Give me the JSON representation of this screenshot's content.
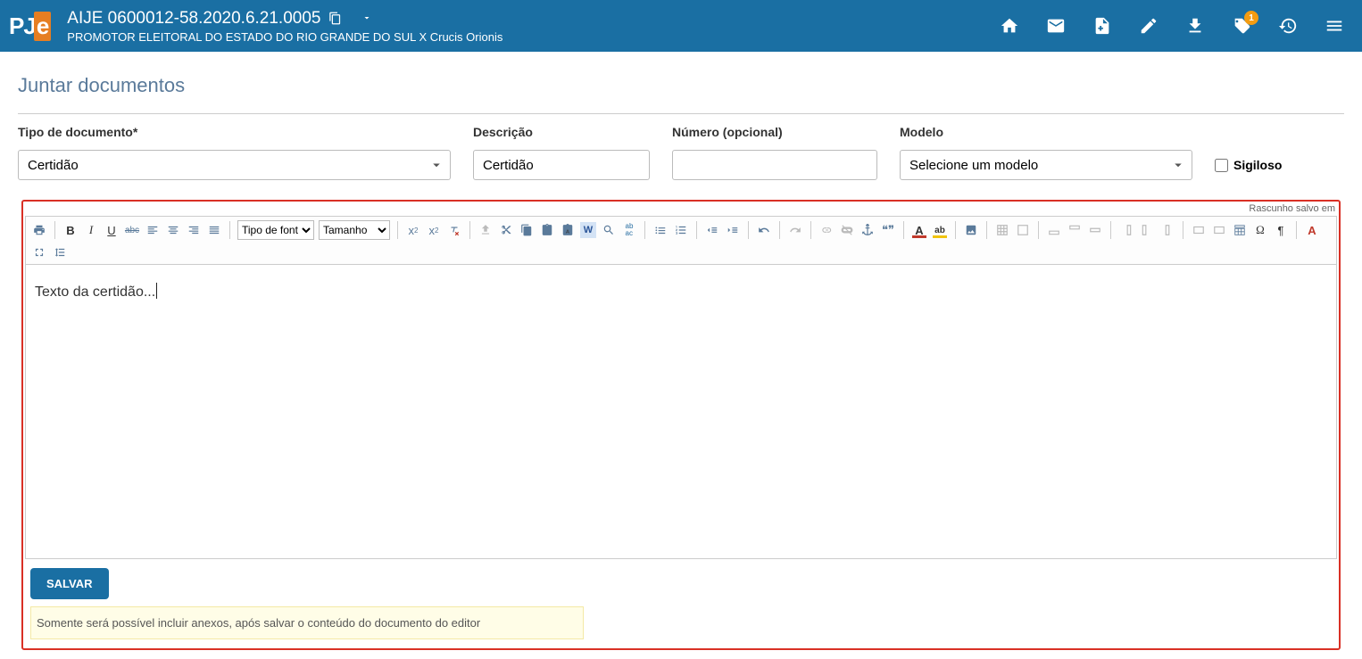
{
  "logo": {
    "p": "PJ",
    "e": "e"
  },
  "header": {
    "case_title": "AIJE 0600012-58.2020.6.21.0005",
    "case_subtitle": "PROMOTOR ELEITORAL DO ESTADO DO RIO GRANDE DO SUL X Crucis Orionis",
    "badge_count": "1"
  },
  "page": {
    "title": "Juntar documentos"
  },
  "form": {
    "tipo_label": "Tipo de documento*",
    "tipo_value": "Certidão",
    "descricao_label": "Descrição",
    "descricao_value": "Certidão",
    "numero_label": "Número (opcional)",
    "numero_value": "",
    "modelo_label": "Modelo",
    "modelo_value": "Selecione um modelo",
    "sigiloso_label": "Sigiloso"
  },
  "editor": {
    "draft_hint": "Rascunho salvo em",
    "font_placeholder": "Tipo de font",
    "size_placeholder": "Tamanho",
    "text": "Texto da certidão...",
    "save_label": "SALVAR",
    "note": "Somente será possível incluir anexos, após salvar o conteúdo do documento do editor",
    "icons": {
      "strike": "abc",
      "sub": "x",
      "sup": "x",
      "quote": "❝❞",
      "omega": "Ω",
      "pilcrow": "¶",
      "W": "W",
      "A": "A",
      "ab": "ab",
      "abac": "ab\nac"
    }
  }
}
